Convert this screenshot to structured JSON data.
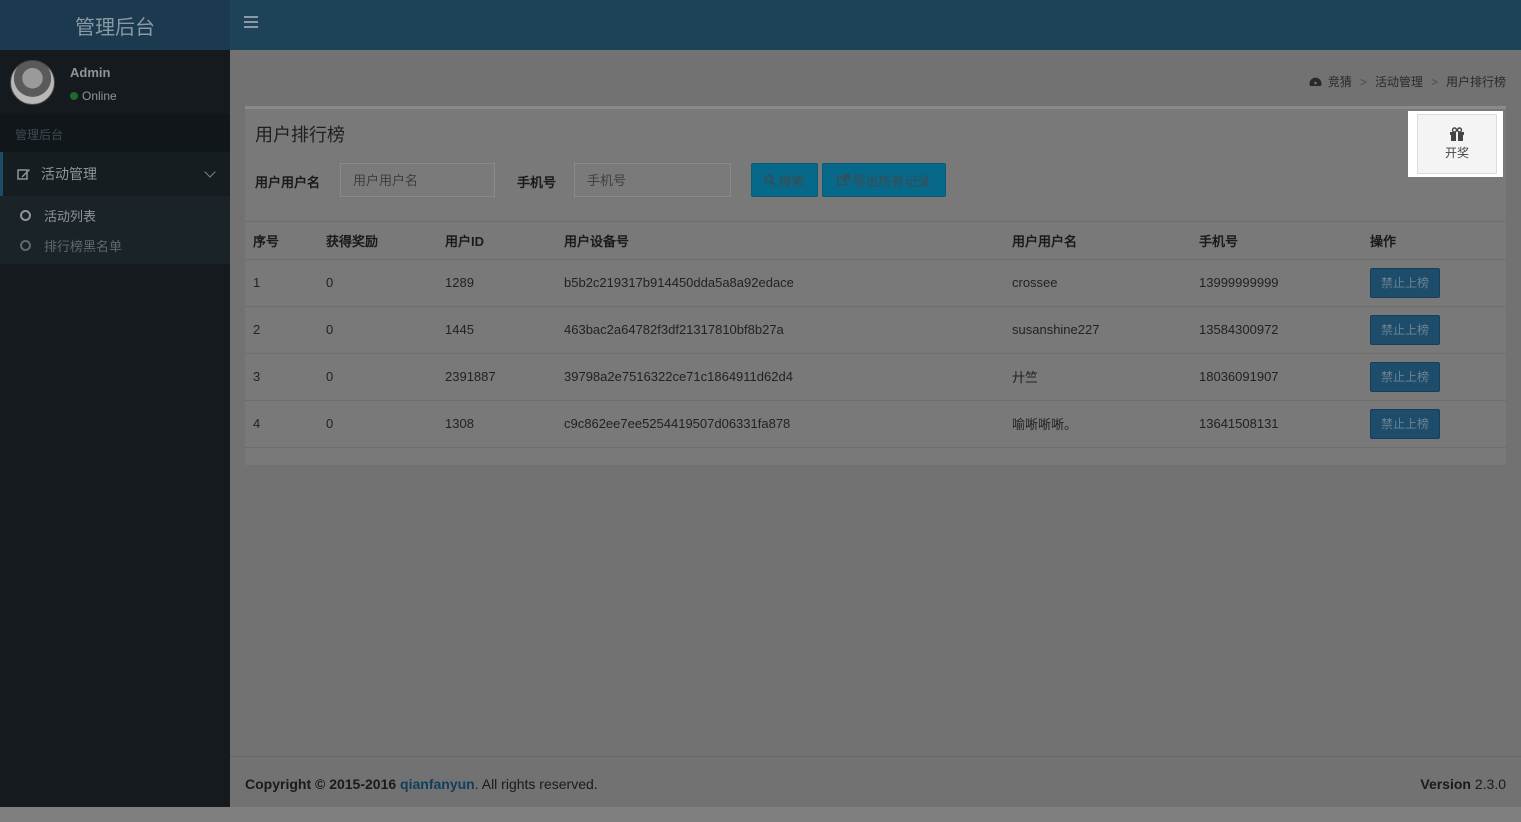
{
  "app": {
    "logo": "管理后台"
  },
  "user": {
    "name": "Admin",
    "status": "Online"
  },
  "sidebar": {
    "header": "管理后台",
    "menu": {
      "label": "活动管理"
    },
    "items": [
      {
        "label": "活动列表"
      },
      {
        "label": "排行榜黑名单"
      }
    ]
  },
  "breadcrumb": {
    "home": "竞猜",
    "section": "活动管理",
    "current": "用户排行榜"
  },
  "box": {
    "title": "用户排行榜",
    "filter": {
      "username_label": "用户用户名",
      "username_placeholder": "用户用户名",
      "phone_label": "手机号",
      "phone_placeholder": "手机号",
      "search_label": "搜索",
      "export_label": "导出所有记录"
    },
    "lottery_label": "开奖",
    "table": {
      "headers": [
        "序号",
        "获得奖励",
        "用户ID",
        "用户设备号",
        "用户用户名",
        "手机号",
        "操作"
      ],
      "rows": [
        {
          "no": "1",
          "reward": "0",
          "uid": "1289",
          "device": "b5b2c219317b914450dda5a8a92edace",
          "username": "crossee",
          "phone": "13999999999",
          "action": "禁止上榜"
        },
        {
          "no": "2",
          "reward": "0",
          "uid": "1445",
          "device": "463bac2a64782f3df21317810bf8b27a",
          "username": "susanshine227",
          "phone": "13584300972",
          "action": "禁止上榜"
        },
        {
          "no": "3",
          "reward": "0",
          "uid": "2391887",
          "device": "39798a2e7516322ce71c1864911d62d4",
          "username": "廾竺",
          "phone": "18036091907",
          "action": "禁止上榜"
        },
        {
          "no": "4",
          "reward": "0",
          "uid": "1308",
          "device": "c9c862ee7ee5254419507d06331fa878",
          "username": "喻唽唽唽。",
          "phone": "13641508131",
          "action": "禁止上榜"
        }
      ]
    }
  },
  "footer": {
    "copyright_prefix": "Copyright © 2015-2016",
    "company": "qianfanyun",
    "rights": ". All rights reserved.",
    "version_label": "Version",
    "version_number": "2.3.0"
  },
  "colors": {
    "header": "#1e4359",
    "sidebar": "#141a1d",
    "button_primary": "#07698a",
    "button_ban": "#1e4d6b"
  }
}
